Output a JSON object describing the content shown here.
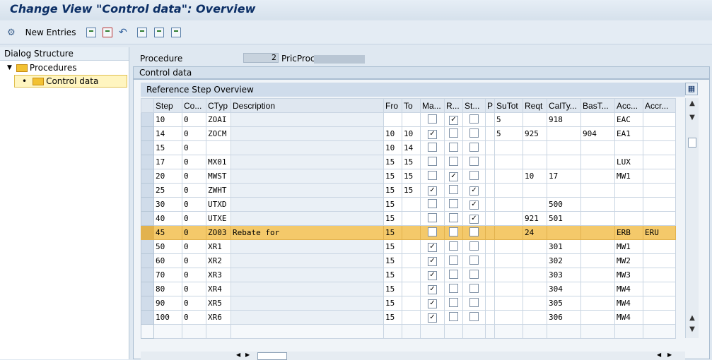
{
  "title": "Change View \"Control data\": Overview",
  "toolbar": {
    "new_entries_label": "New Entries"
  },
  "dialog_structure": {
    "heading": "Dialog Structure",
    "items": [
      {
        "label": "Procedures"
      },
      {
        "label": "Control data"
      }
    ]
  },
  "procedure": {
    "label": "Procedure",
    "value": "2",
    "pricproc_label": "PricProc"
  },
  "control_data": {
    "heading": "Control data",
    "ref_heading": "Reference Step Overview",
    "columns": [
      "Step",
      "Co...",
      "CTyp",
      "Description",
      "Fro",
      "To",
      "Ma...",
      "R...",
      "St...",
      "P",
      "SuTot",
      "Reqt",
      "CalTy...",
      "BasT...",
      "Acc...",
      "Accr..."
    ],
    "rows": [
      {
        "step": "10",
        "co": "0",
        "ctyp": "ZOAI",
        "desc": "",
        "fro": "",
        "to": "",
        "ma": false,
        "r": true,
        "st": false,
        "p": "",
        "sutot": "5",
        "reqt": "",
        "calty": "918",
        "bast": "",
        "acc": "EAC",
        "accr": ""
      },
      {
        "step": "14",
        "co": "0",
        "ctyp": "ZOCM",
        "desc": "",
        "fro": "10",
        "to": "10",
        "ma": true,
        "r": false,
        "st": false,
        "p": "",
        "sutot": "5",
        "reqt": "925",
        "calty": "",
        "bast": "904",
        "acc": "EA1",
        "accr": ""
      },
      {
        "step": "15",
        "co": "0",
        "ctyp": "",
        "desc": "",
        "fro": "10",
        "to": "14",
        "ma": false,
        "r": false,
        "st": false,
        "p": "",
        "sutot": "",
        "reqt": "",
        "calty": "",
        "bast": "",
        "acc": "",
        "accr": ""
      },
      {
        "step": "17",
        "co": "0",
        "ctyp": "MX01",
        "desc": "",
        "fro": "15",
        "to": "15",
        "ma": false,
        "r": false,
        "st": false,
        "p": "",
        "sutot": "",
        "reqt": "",
        "calty": "",
        "bast": "",
        "acc": "LUX",
        "accr": ""
      },
      {
        "step": "20",
        "co": "0",
        "ctyp": "MWST",
        "desc": "",
        "fro": "15",
        "to": "15",
        "ma": false,
        "r": true,
        "st": false,
        "p": "",
        "sutot": "",
        "reqt": "10",
        "calty": "17",
        "bast": "",
        "acc": "MW1",
        "accr": ""
      },
      {
        "step": "25",
        "co": "0",
        "ctyp": "ZWHT",
        "desc": "",
        "fro": "15",
        "to": "15",
        "ma": true,
        "r": false,
        "st": true,
        "p": "",
        "sutot": "",
        "reqt": "",
        "calty": "",
        "bast": "",
        "acc": "",
        "accr": ""
      },
      {
        "step": "30",
        "co": "0",
        "ctyp": "UTXD",
        "desc": "",
        "fro": "15",
        "to": "",
        "ma": false,
        "r": false,
        "st": true,
        "p": "",
        "sutot": "",
        "reqt": "",
        "calty": "500",
        "bast": "",
        "acc": "",
        "accr": ""
      },
      {
        "step": "40",
        "co": "0",
        "ctyp": "UTXE",
        "desc": "",
        "fro": "15",
        "to": "",
        "ma": false,
        "r": false,
        "st": true,
        "p": "",
        "sutot": "",
        "reqt": "921",
        "calty": "501",
        "bast": "",
        "acc": "",
        "accr": ""
      },
      {
        "step": "45",
        "co": "0",
        "ctyp": "ZO03",
        "desc": "Rebate for",
        "fro": "15",
        "to": "",
        "ma": false,
        "r": false,
        "st": false,
        "p": "",
        "sutot": "",
        "reqt": "24",
        "calty": "",
        "bast": "",
        "acc": "ERB",
        "accr": "ERU"
      },
      {
        "step": "50",
        "co": "0",
        "ctyp": "XR1",
        "desc": "",
        "fro": "15",
        "to": "",
        "ma": true,
        "r": false,
        "st": false,
        "p": "",
        "sutot": "",
        "reqt": "",
        "calty": "301",
        "bast": "",
        "acc": "MW1",
        "accr": ""
      },
      {
        "step": "60",
        "co": "0",
        "ctyp": "XR2",
        "desc": "",
        "fro": "15",
        "to": "",
        "ma": true,
        "r": false,
        "st": false,
        "p": "",
        "sutot": "",
        "reqt": "",
        "calty": "302",
        "bast": "",
        "acc": "MW2",
        "accr": ""
      },
      {
        "step": "70",
        "co": "0",
        "ctyp": "XR3",
        "desc": "",
        "fro": "15",
        "to": "",
        "ma": true,
        "r": false,
        "st": false,
        "p": "",
        "sutot": "",
        "reqt": "",
        "calty": "303",
        "bast": "",
        "acc": "MW3",
        "accr": ""
      },
      {
        "step": "80",
        "co": "0",
        "ctyp": "XR4",
        "desc": "",
        "fro": "15",
        "to": "",
        "ma": true,
        "r": false,
        "st": false,
        "p": "",
        "sutot": "",
        "reqt": "",
        "calty": "304",
        "bast": "",
        "acc": "MW4",
        "accr": ""
      },
      {
        "step": "90",
        "co": "0",
        "ctyp": "XR5",
        "desc": "",
        "fro": "15",
        "to": "",
        "ma": true,
        "r": false,
        "st": false,
        "p": "",
        "sutot": "",
        "reqt": "",
        "calty": "305",
        "bast": "",
        "acc": "MW4",
        "accr": ""
      },
      {
        "step": "100",
        "co": "0",
        "ctyp": "XR6",
        "desc": "",
        "fro": "15",
        "to": "",
        "ma": true,
        "r": false,
        "st": false,
        "p": "",
        "sutot": "",
        "reqt": "",
        "calty": "306",
        "bast": "",
        "acc": "MW4",
        "accr": ""
      }
    ],
    "highlight_step": "45"
  },
  "colors": {
    "title": "#0c2f66",
    "highlight": "#f4c96a",
    "header_bg": "#dfe7f0"
  }
}
